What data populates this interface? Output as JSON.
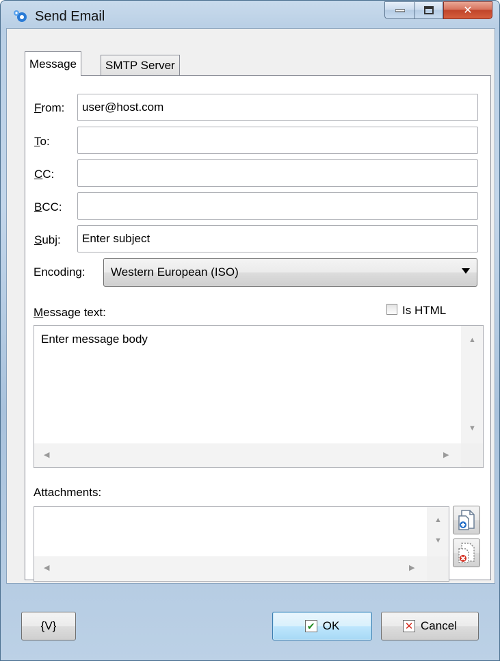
{
  "window": {
    "title": "Send Email"
  },
  "tabs": [
    {
      "label": "Message",
      "selected": true
    },
    {
      "label": "SMTP Server",
      "selected": false
    }
  ],
  "form": {
    "from": {
      "label_key": "F",
      "label_rest": "rom:",
      "value": "user@host.com"
    },
    "to": {
      "label_key": "T",
      "label_rest": "o:",
      "value": ""
    },
    "cc": {
      "label_key": "C",
      "label_rest": "C:",
      "value": ""
    },
    "bcc": {
      "label_key": "B",
      "label_rest": "CC:",
      "value": ""
    },
    "subj": {
      "label_key": "S",
      "label_rest": "ubj:",
      "value": "Enter subject"
    },
    "encoding": {
      "label": "Encoding:",
      "selected": "Western European (ISO)"
    },
    "message_text": {
      "label_key": "M",
      "label_rest": "essage text:",
      "value": "Enter message body"
    },
    "is_html": {
      "label": "Is HTML",
      "checked": false
    },
    "attachments": {
      "label": "Attachments:"
    }
  },
  "buttons": {
    "variables": "{V}",
    "ok": "OK",
    "cancel": "Cancel"
  },
  "colors": {
    "accent": "#3c7fb1",
    "ok_check": "#1d8a1d",
    "cancel_x": "#d42a1c"
  }
}
